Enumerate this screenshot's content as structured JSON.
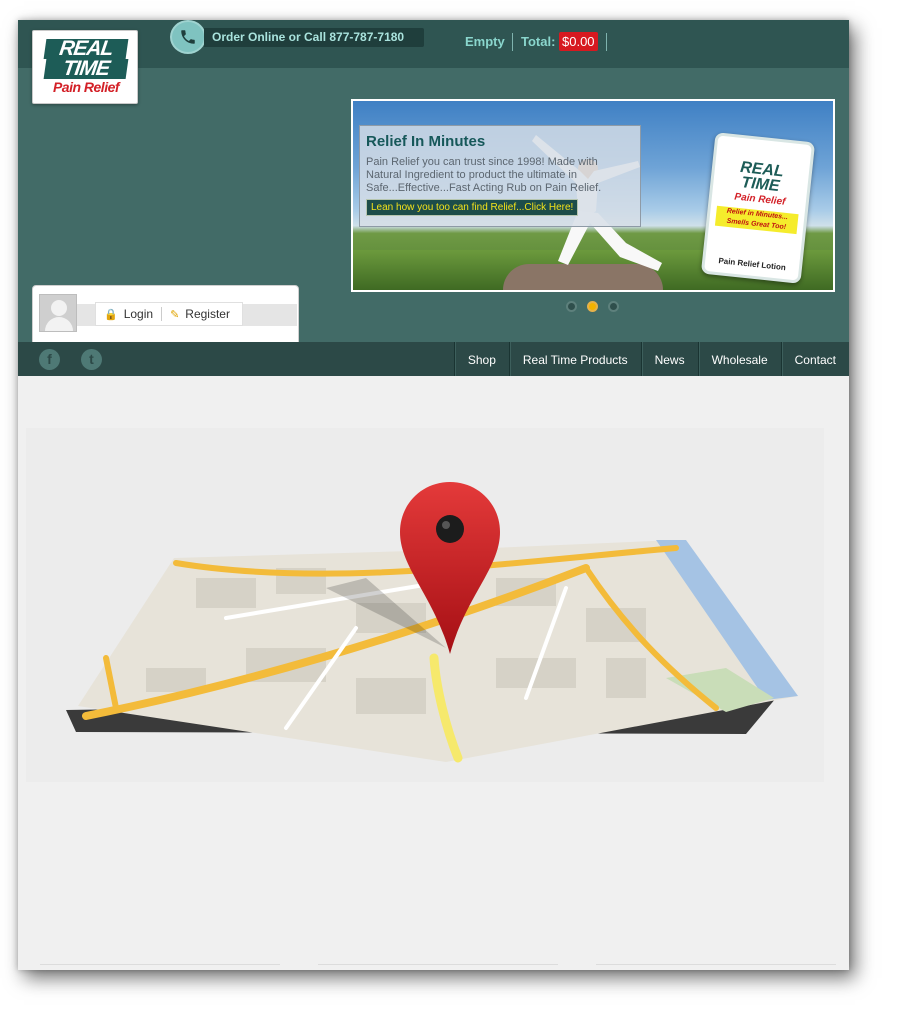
{
  "header": {
    "logo": {
      "line1": "REAL",
      "line2": "TIME",
      "line3": "Pain Relief"
    },
    "phone_text": "Order Online or Call 877-787-7180",
    "cart": {
      "status": "Empty",
      "total_label": "Total:",
      "total_value": "$0.00"
    }
  },
  "slider": {
    "title": "Relief In Minutes",
    "text": "Pain Relief you can trust since 1998! Made with Natural Ingredient to product the ultimate in Safe...Effective...Fast Acting Rub on Pain Relief.",
    "cta": "Lean how you too can find Relief...Click Here!",
    "product": {
      "brand_top": "REAL",
      "brand_bottom": "TIME",
      "sub": "Pain Relief",
      "slogan": "Relief in Minutes... Smells Great Too!",
      "label": "Pain Relief Lotion"
    },
    "active_slide": 2
  },
  "account": {
    "login": "Login",
    "register": "Register"
  },
  "nav": {
    "items": [
      "Shop",
      "Real Time Products",
      "News",
      "Wholesale",
      "Contact"
    ]
  },
  "colors": {
    "brand_teal": "#426b67",
    "dark_teal": "#2f5552",
    "accent_red": "#d71920",
    "nav_bg": "#2c4947"
  }
}
